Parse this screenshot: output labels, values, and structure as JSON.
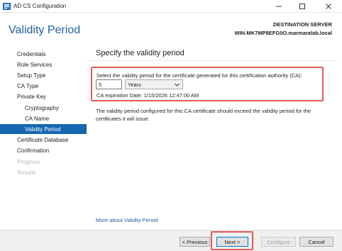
{
  "window": {
    "title": "AD CS Configuration",
    "controls": [
      "minimize-icon",
      "maximize-icon",
      "close-icon"
    ]
  },
  "header": {
    "page_title": "Validity Period",
    "destination_label": "DESTINATION SERVER",
    "destination_server": "WIN-MK7MP8EFG0O.marmaralab.local"
  },
  "nav": {
    "items": [
      {
        "label": "Credentials",
        "state": "normal"
      },
      {
        "label": "Role Services",
        "state": "normal"
      },
      {
        "label": "Setup Type",
        "state": "normal"
      },
      {
        "label": "CA Type",
        "state": "normal"
      },
      {
        "label": "Private Key",
        "state": "normal"
      },
      {
        "label": "Cryptography",
        "state": "normal"
      },
      {
        "label": "CA Name",
        "state": "normal"
      },
      {
        "label": "Validity Period",
        "state": "active"
      },
      {
        "label": "Certificate Database",
        "state": "normal"
      },
      {
        "label": "Confirmation",
        "state": "normal"
      },
      {
        "label": "Progress",
        "state": "disabled"
      },
      {
        "label": "Results",
        "state": "disabled"
      }
    ]
  },
  "content": {
    "title": "Specify the validity period",
    "prompt": "Select the validity period for the certificate generated for this certification authority (CA):",
    "period_value": "5",
    "period_unit": "Years",
    "expiration": "CA expiration Date: 1/15/2026 12:47:00 AM",
    "info": "The validity period configured for this CA certificate should exceed the validity period for the certificates it will issue.",
    "more_link": "More about Validity Period"
  },
  "footer": {
    "previous": "< Previous",
    "next": "Next >",
    "configure": "Configure",
    "cancel": "Cancel"
  },
  "colors": {
    "accent": "#1567b0",
    "title_blue": "#1f5f9e",
    "highlight": "#e05a55"
  }
}
